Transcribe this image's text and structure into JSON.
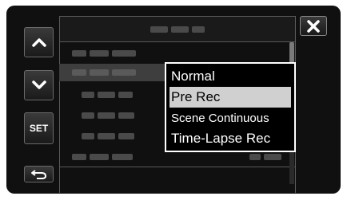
{
  "buttons": {
    "up_icon": "chevron-up-icon",
    "down_icon": "chevron-down-icon",
    "set_label": "SET",
    "back_icon": "return-arrow-icon",
    "close_icon": "close-icon"
  },
  "popup": {
    "options": [
      {
        "label": "Normal",
        "selected": false
      },
      {
        "label": "Pre Rec",
        "selected": true
      },
      {
        "label": "Scene Continuous",
        "selected": false
      },
      {
        "label": "Time-Lapse Rec",
        "selected": false
      }
    ]
  },
  "colors": {
    "background": "#101010",
    "highlight": "#d0d0d0",
    "row_highlight": "#3e3e3e",
    "text": "#ffffff"
  }
}
